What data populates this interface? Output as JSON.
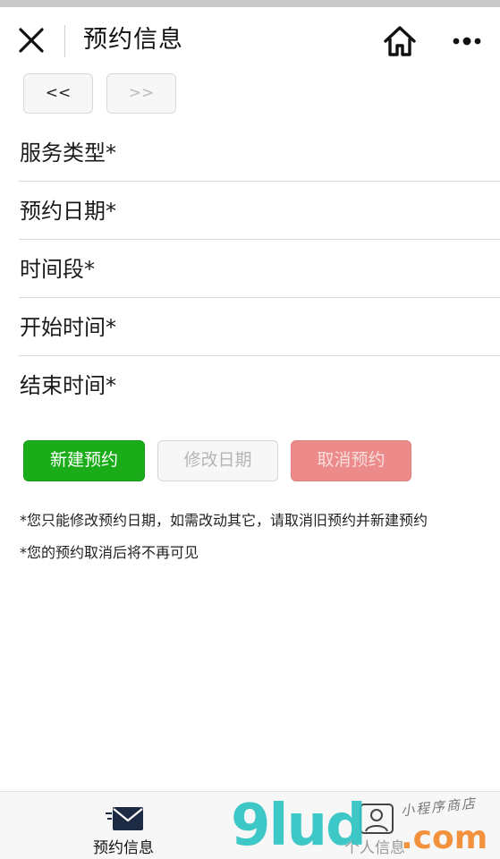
{
  "navbar": {
    "title": "预约信息",
    "close_icon": "close-icon",
    "home_icon": "home-icon",
    "more_icon": "more-dots-icon"
  },
  "pager": {
    "prev_label": "<<",
    "next_label": ">>"
  },
  "form": {
    "fields": [
      {
        "label": "服务类型*"
      },
      {
        "label": "预约日期*"
      },
      {
        "label": "时间段*"
      },
      {
        "label": "开始时间*"
      },
      {
        "label": "结束时间*"
      }
    ]
  },
  "actions": {
    "new_label": "新建预约",
    "modify_label": "修改日期",
    "cancel_label": "取消预约"
  },
  "notes": [
    "*您只能修改预约日期，如需改动其它，请取消旧预约并新建预约",
    "*您的预约取消后将不再可见"
  ],
  "tabbar": {
    "items": [
      {
        "label": "预约信息",
        "icon": "envelope-icon",
        "active": true
      },
      {
        "label": "个人信息",
        "icon": "person-icon",
        "active": false
      }
    ]
  },
  "watermark": {
    "main": "9lud",
    "suffix": ".com",
    "small": "小程序商店"
  },
  "colors": {
    "primary": "#1aad19",
    "danger": "#ec8b89",
    "disabled_text": "#b5b5b5"
  }
}
